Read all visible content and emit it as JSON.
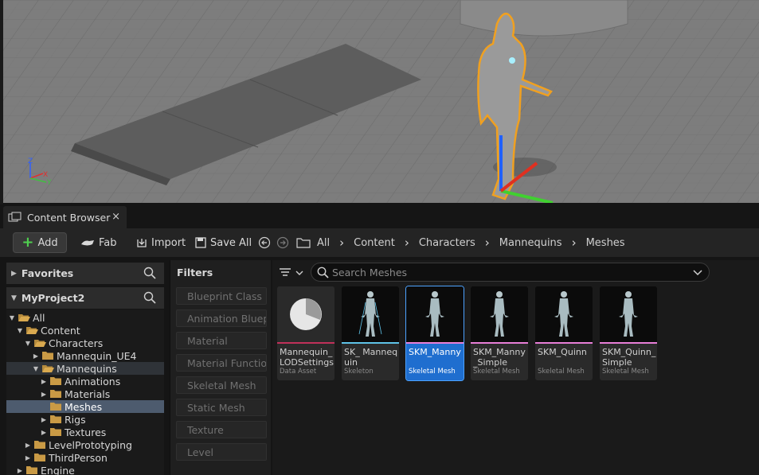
{
  "viewport": {
    "axis_labels": {
      "z": "Z",
      "x": "X",
      "y": "Y"
    }
  },
  "tabs": {
    "content_browser": "Content Browser",
    "close": "×"
  },
  "toolbar": {
    "add": "Add",
    "fab": "Fab",
    "import": "Import",
    "save_all": "Save All"
  },
  "breadcrumb": [
    "All",
    "Content",
    "Characters",
    "Mannequins",
    "Meshes"
  ],
  "sidebar": {
    "favorites": "Favorites",
    "project": "MyProject2",
    "tree": [
      {
        "label": "All"
      },
      {
        "label": "Content"
      },
      {
        "label": "Characters"
      },
      {
        "label": "Mannequin_UE4"
      },
      {
        "label": "Mannequins"
      },
      {
        "label": "Animations"
      },
      {
        "label": "Materials"
      },
      {
        "label": "Meshes"
      },
      {
        "label": "Rigs"
      },
      {
        "label": "Textures"
      },
      {
        "label": "LevelPrototyping"
      },
      {
        "label": "ThirdPerson"
      },
      {
        "label": "Engine"
      }
    ]
  },
  "filters": {
    "title": "Filters",
    "items": [
      "Blueprint Class",
      "Animation Bluepr",
      "Material",
      "Material Functior",
      "Skeletal Mesh",
      "Static Mesh",
      "Texture",
      "Level"
    ]
  },
  "search": {
    "placeholder": "Search Meshes"
  },
  "assets": [
    {
      "name": "Mannequin_LODSettings",
      "type": "Data Asset",
      "color": "#c0305a"
    },
    {
      "name": "SK_Mannequin",
      "type": "Skeleton",
      "color": "#5fc3e8"
    },
    {
      "name": "SKM_Manny",
      "type": "Skeletal Mesh",
      "color": "#e87fd8"
    },
    {
      "name": "SKM_Manny_Simple",
      "type": "Skeletal Mesh",
      "color": "#e87fd8"
    },
    {
      "name": "SKM_Quinn",
      "type": "Skeletal Mesh",
      "color": "#e87fd8"
    },
    {
      "name": "SKM_Quinn_Simple",
      "type": "Skeletal Mesh",
      "color": "#e87fd8"
    }
  ],
  "asset_display_names": [
    "Mannequin_ LODSettings",
    "SK_ Mannequin",
    "SKM_Manny",
    "SKM_Manny _Simple",
    "SKM_Quinn",
    "SKM_Quinn_ Simple"
  ]
}
